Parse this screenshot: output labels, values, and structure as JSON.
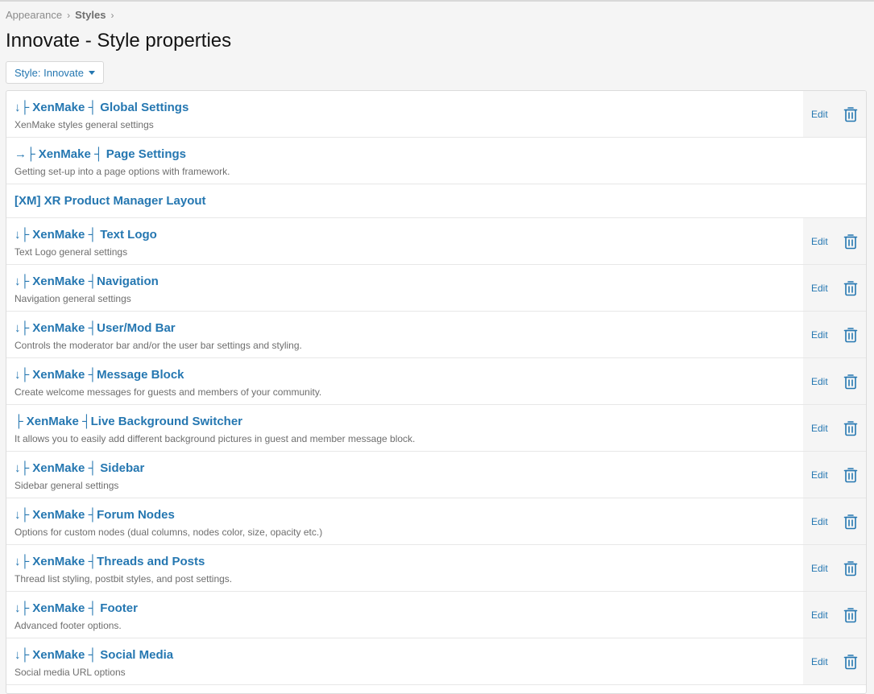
{
  "breadcrumb": [
    "Appearance",
    "Styles"
  ],
  "page_title": "Innovate - Style properties",
  "style_selector": {
    "label": "Style: Innovate"
  },
  "colors": {
    "accent": "#2577b1",
    "muted": "#6e6e6e"
  },
  "rows": [
    {
      "title": "↓├ XenMake ┤ Global Settings",
      "desc": "XenMake styles general settings",
      "actions": true,
      "edit": "Edit"
    },
    {
      "title": "→├ XenMake ┤ Page Settings",
      "desc": "Getting set-up into a page options with framework.",
      "actions": false
    },
    {
      "title": "[XM] XR Product Manager Layout",
      "desc": "",
      "actions": false
    },
    {
      "title": "↓├ XenMake ┤ Text Logo",
      "desc": "Text Logo general settings",
      "actions": true,
      "edit": "Edit"
    },
    {
      "title": "↓├ XenMake ┤Navigation",
      "desc": "Navigation general settings",
      "actions": true,
      "edit": "Edit"
    },
    {
      "title": "↓├ XenMake ┤User/Mod Bar",
      "desc": "Controls the moderator bar and/or the user bar settings and styling.",
      "actions": true,
      "edit": "Edit"
    },
    {
      "title": "↓├ XenMake ┤Message Block",
      "desc": "Create welcome messages for guests and members of your community.",
      "actions": true,
      "edit": "Edit"
    },
    {
      "title": "├ XenMake ┤Live Background Switcher",
      "desc": "It allows you to easily add different background pictures in guest and member message block.",
      "actions": true,
      "edit": "Edit"
    },
    {
      "title": "↓├ XenMake ┤ Sidebar",
      "desc": "Sidebar general settings",
      "actions": true,
      "edit": "Edit"
    },
    {
      "title": "↓├ XenMake ┤Forum Nodes",
      "desc": "Options for custom nodes (dual columns, nodes color, size, opacity etc.)",
      "actions": true,
      "edit": "Edit"
    },
    {
      "title": "↓├ XenMake ┤Threads and Posts",
      "desc": "Thread list styling, postbit styles, and post settings.",
      "actions": true,
      "edit": "Edit"
    },
    {
      "title": "↓├ XenMake ┤ Footer",
      "desc": "Advanced footer options.",
      "actions": true,
      "edit": "Edit"
    },
    {
      "title": "↓├ XenMake ┤ Social Media",
      "desc": "Social media URL options",
      "actions": true,
      "edit": "Edit"
    }
  ]
}
